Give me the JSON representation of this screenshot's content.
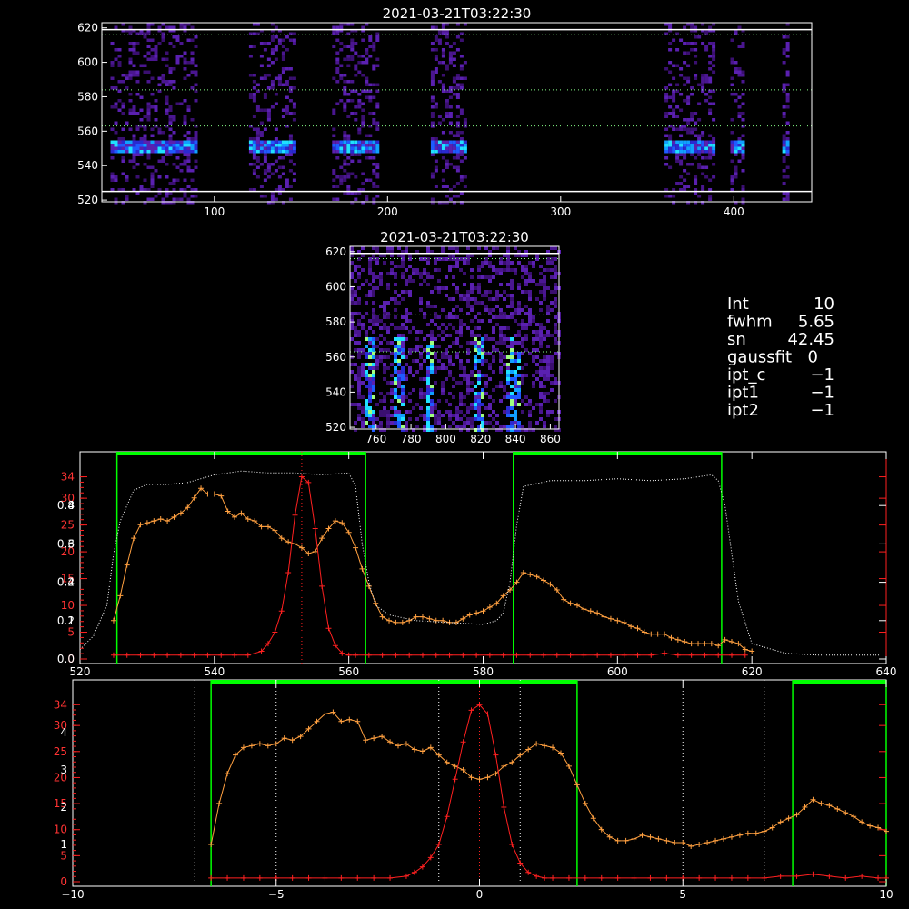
{
  "colors": {
    "frame": "#ffffff",
    "red": "#ff2020",
    "orange": "#ffa040",
    "green": "#00ff00",
    "dotted_white": "#ffffff",
    "dotted_green": "#88ff88"
  },
  "chart_data": [
    {
      "id": "top-image",
      "type": "heatmap",
      "title": "2021-03-21T03:22:30",
      "xlim": [
        35,
        445
      ],
      "ylim": [
        519,
        623
      ],
      "xticks": [
        100,
        200,
        300,
        400
      ],
      "yticks": [
        520,
        540,
        560,
        580,
        600,
        620
      ],
      "columns": [
        [
          40,
          90
        ],
        [
          120,
          146
        ],
        [
          168,
          195
        ],
        [
          225,
          245
        ],
        [
          360,
          388
        ],
        [
          398,
          406
        ],
        [
          428,
          431
        ]
      ],
      "rows": {
        "solid": [
          525,
          619
        ],
        "dotted_green": [
          563,
          584,
          616
        ],
        "dotted_red": [
          552
        ]
      },
      "emission_row": 552
    },
    {
      "id": "zoom-image",
      "type": "heatmap",
      "title": "2021-03-21T03:22:30",
      "xlim": [
        745,
        865
      ],
      "ylim": [
        519,
        623
      ],
      "xticks": [
        760,
        780,
        800,
        820,
        840,
        860
      ],
      "yticks": [
        520,
        540,
        560,
        580,
        600,
        620
      ],
      "bright_columns": [
        [
          753,
          758
        ],
        [
          770,
          776
        ],
        [
          787,
          792
        ],
        [
          815,
          822
        ],
        [
          834,
          842
        ]
      ],
      "rows": {
        "solid": [
          619
        ],
        "dotted_green": [
          563,
          584,
          616
        ]
      }
    },
    {
      "id": "spectrum-plot",
      "type": "line",
      "xlim": [
        520,
        640
      ],
      "ylim": [
        0,
        1
      ],
      "xticks": [
        520,
        540,
        560,
        580,
        600,
        620,
        640
      ],
      "yticks_left_white": [
        "0.0",
        "0.2",
        "0.4",
        "0.6",
        "0.8"
      ],
      "yticks_left_red": [
        "0",
        "5",
        "10",
        "15",
        "20",
        "25",
        "30",
        "34"
      ],
      "yticks_left_white_extra": [
        "1",
        "2",
        "3",
        "4"
      ],
      "green_windows": [
        [
          525.5,
          562.5
        ],
        [
          584.5,
          615.5
        ]
      ],
      "series": [
        {
          "color": "orange",
          "x": [
            525,
            526,
            527,
            528,
            529,
            530,
            531,
            532,
            533,
            534,
            535,
            536,
            537,
            538,
            539,
            540,
            541,
            542,
            543,
            544,
            545,
            546,
            547,
            548,
            549,
            550,
            551,
            552,
            553,
            554,
            555,
            556,
            557,
            558,
            559,
            560,
            561,
            562,
            563,
            564,
            565,
            566,
            567,
            568,
            569,
            570,
            571,
            572,
            573,
            574,
            575,
            576,
            577,
            578,
            579,
            580,
            581,
            582,
            583,
            584,
            585,
            586,
            587,
            588,
            589,
            590,
            591,
            592,
            593,
            594,
            595,
            596,
            597,
            598,
            599,
            600,
            601,
            602,
            603,
            604,
            605,
            606,
            607,
            608,
            609,
            610,
            611,
            612,
            613,
            614,
            615,
            616,
            617,
            618,
            619,
            620
          ],
          "y": [
            0.2,
            0.33,
            0.49,
            0.63,
            0.7,
            0.71,
            0.72,
            0.73,
            0.72,
            0.74,
            0.76,
            0.79,
            0.84,
            0.89,
            0.86,
            0.86,
            0.85,
            0.77,
            0.74,
            0.76,
            0.73,
            0.72,
            0.69,
            0.69,
            0.67,
            0.63,
            0.61,
            0.6,
            0.58,
            0.55,
            0.56,
            0.63,
            0.68,
            0.72,
            0.71,
            0.66,
            0.58,
            0.47,
            0.38,
            0.29,
            0.22,
            0.2,
            0.19,
            0.19,
            0.2,
            0.22,
            0.22,
            0.21,
            0.2,
            0.2,
            0.19,
            0.19,
            0.21,
            0.23,
            0.24,
            0.25,
            0.27,
            0.29,
            0.33,
            0.36,
            0.4,
            0.45,
            0.44,
            0.43,
            0.41,
            0.39,
            0.36,
            0.31,
            0.29,
            0.28,
            0.26,
            0.25,
            0.24,
            0.22,
            0.21,
            0.2,
            0.19,
            0.17,
            0.16,
            0.14,
            0.13,
            0.13,
            0.13,
            0.11,
            0.1,
            0.09,
            0.08,
            0.08,
            0.08,
            0.08,
            0.07,
            0.1,
            0.09,
            0.08,
            0.05,
            0.04
          ]
        },
        {
          "color": "red",
          "x": [
            525,
            527,
            529,
            531,
            533,
            535,
            537,
            539,
            541,
            543,
            545,
            547,
            548,
            549,
            550,
            551,
            552,
            553,
            554,
            555,
            556,
            557,
            558,
            559,
            560,
            561,
            563,
            565,
            567,
            569,
            571,
            573,
            575,
            577,
            579,
            581,
            583,
            585,
            587,
            589,
            591,
            593,
            595,
            597,
            599,
            601,
            603,
            605,
            607,
            609,
            611,
            613,
            615,
            617,
            619
          ],
          "y": [
            0.02,
            0.02,
            0.02,
            0.02,
            0.02,
            0.02,
            0.02,
            0.02,
            0.02,
            0.02,
            0.02,
            0.04,
            0.08,
            0.14,
            0.25,
            0.45,
            0.75,
            0.95,
            0.92,
            0.68,
            0.38,
            0.16,
            0.07,
            0.03,
            0.02,
            0.02,
            0.02,
            0.02,
            0.02,
            0.02,
            0.02,
            0.02,
            0.02,
            0.02,
            0.02,
            0.02,
            0.02,
            0.02,
            0.02,
            0.02,
            0.02,
            0.02,
            0.02,
            0.02,
            0.02,
            0.02,
            0.02,
            0.02,
            0.03,
            0.02,
            0.02,
            0.02,
            0.02,
            0.02,
            0.02
          ]
        },
        {
          "color": "white-dotted",
          "x": [
            520,
            522,
            524,
            525,
            526,
            528,
            530,
            533,
            536,
            540,
            544,
            548,
            552,
            556,
            560,
            561,
            562,
            563,
            564,
            566,
            570,
            575,
            580,
            582,
            583,
            584,
            585,
            586,
            590,
            595,
            600,
            605,
            610,
            614,
            615,
            616,
            617,
            618,
            620,
            625,
            630,
            639
          ],
          "y": [
            0.05,
            0.12,
            0.28,
            0.55,
            0.72,
            0.88,
            0.91,
            0.91,
            0.92,
            0.96,
            0.98,
            0.97,
            0.97,
            0.96,
            0.97,
            0.9,
            0.6,
            0.4,
            0.28,
            0.23,
            0.2,
            0.19,
            0.18,
            0.2,
            0.24,
            0.4,
            0.7,
            0.9,
            0.93,
            0.93,
            0.94,
            0.93,
            0.94,
            0.96,
            0.93,
            0.8,
            0.55,
            0.3,
            0.08,
            0.03,
            0.02,
            0.02
          ]
        }
      ]
    },
    {
      "id": "velocity-plot",
      "type": "line",
      "xlim": [
        -10,
        10
      ],
      "ylim": [
        0,
        1
      ],
      "xticks": [
        "−10",
        "−5",
        "0",
        "5",
        "10"
      ],
      "yticks_left_red": [
        "0",
        "5",
        "10",
        "15",
        "20",
        "25",
        "30",
        "34"
      ],
      "yticks_left_white": [
        "1",
        "2",
        "3",
        "4"
      ],
      "green_windows": [
        [
          -6.6,
          2.4
        ],
        [
          7.7,
          10
        ]
      ],
      "dotted_lines": [
        -7,
        -5,
        -1,
        1,
        5,
        7
      ],
      "series": [
        {
          "color": "orange",
          "x": [
            -6.6,
            -6.4,
            -6.2,
            -6.0,
            -5.8,
            -5.6,
            -5.4,
            -5.2,
            -5.0,
            -4.8,
            -4.6,
            -4.4,
            -4.2,
            -4.0,
            -3.8,
            -3.6,
            -3.4,
            -3.2,
            -3.0,
            -2.8,
            -2.6,
            -2.4,
            -2.2,
            -2.0,
            -1.8,
            -1.6,
            -1.4,
            -1.2,
            -1.0,
            -0.8,
            -0.6,
            -0.4,
            -0.2,
            0.0,
            0.2,
            0.4,
            0.6,
            0.8,
            1.0,
            1.2,
            1.4,
            1.6,
            1.8,
            2.0,
            2.2,
            2.4,
            2.6,
            2.8,
            3.0,
            3.2,
            3.4,
            3.6,
            3.8,
            4.0,
            4.2,
            4.4,
            4.6,
            4.8,
            5.0,
            5.2,
            5.4,
            5.6,
            5.8,
            6.0,
            6.2,
            6.4,
            6.6,
            6.8,
            7.0,
            7.2,
            7.4,
            7.6,
            7.8,
            8.0,
            8.2,
            8.4,
            8.6,
            8.8,
            9.0,
            9.2,
            9.4,
            9.6,
            9.8,
            10.0
          ],
          "y": [
            0.2,
            0.42,
            0.58,
            0.68,
            0.72,
            0.73,
            0.74,
            0.73,
            0.74,
            0.77,
            0.76,
            0.78,
            0.82,
            0.86,
            0.9,
            0.91,
            0.86,
            0.87,
            0.86,
            0.76,
            0.77,
            0.78,
            0.75,
            0.73,
            0.74,
            0.71,
            0.7,
            0.72,
            0.68,
            0.64,
            0.62,
            0.6,
            0.56,
            0.55,
            0.56,
            0.58,
            0.62,
            0.64,
            0.68,
            0.71,
            0.74,
            0.73,
            0.72,
            0.69,
            0.62,
            0.52,
            0.42,
            0.34,
            0.28,
            0.24,
            0.22,
            0.22,
            0.23,
            0.25,
            0.24,
            0.23,
            0.22,
            0.21,
            0.21,
            0.19,
            0.2,
            0.21,
            0.22,
            0.23,
            0.24,
            0.25,
            0.26,
            0.26,
            0.27,
            0.29,
            0.32,
            0.34,
            0.36,
            0.4,
            0.44,
            0.42,
            0.41,
            0.39,
            0.37,
            0.35,
            0.32,
            0.3,
            0.29,
            0.27
          ]
        },
        {
          "color": "red",
          "x": [
            -6.6,
            -6.2,
            -5.8,
            -5.4,
            -5.0,
            -4.6,
            -4.2,
            -3.8,
            -3.4,
            -3.0,
            -2.6,
            -2.2,
            -1.8,
            -1.6,
            -1.4,
            -1.2,
            -1.0,
            -0.8,
            -0.6,
            -0.4,
            -0.2,
            0.0,
            0.2,
            0.4,
            0.6,
            0.8,
            1.0,
            1.2,
            1.4,
            1.6,
            1.8,
            2.2,
            2.6,
            3.0,
            3.4,
            3.8,
            4.2,
            4.6,
            5.0,
            5.4,
            5.8,
            6.2,
            6.6,
            7.0,
            7.4,
            7.8,
            8.2,
            8.6,
            9.0,
            9.4,
            9.8,
            10.0
          ],
          "y": [
            0.02,
            0.02,
            0.02,
            0.02,
            0.02,
            0.02,
            0.02,
            0.02,
            0.02,
            0.02,
            0.02,
            0.02,
            0.03,
            0.05,
            0.08,
            0.13,
            0.2,
            0.35,
            0.55,
            0.75,
            0.92,
            0.95,
            0.9,
            0.68,
            0.4,
            0.2,
            0.1,
            0.05,
            0.03,
            0.02,
            0.02,
            0.02,
            0.02,
            0.02,
            0.02,
            0.02,
            0.02,
            0.02,
            0.02,
            0.02,
            0.02,
            0.02,
            0.02,
            0.02,
            0.03,
            0.03,
            0.04,
            0.03,
            0.02,
            0.03,
            0.02,
            0.02
          ]
        }
      ]
    }
  ],
  "info": {
    "rows": [
      {
        "label": "Int",
        "value": "10"
      },
      {
        "label": "fwhm",
        "value": "5.65"
      },
      {
        "label": "sn",
        "value": "42.45"
      },
      {
        "label": "gaussfit",
        "value": "0"
      },
      {
        "label": "ipt_c",
        "value": "−1"
      },
      {
        "label": "ipt1",
        "value": "−1"
      },
      {
        "label": "ipt2",
        "value": "−1"
      }
    ]
  }
}
